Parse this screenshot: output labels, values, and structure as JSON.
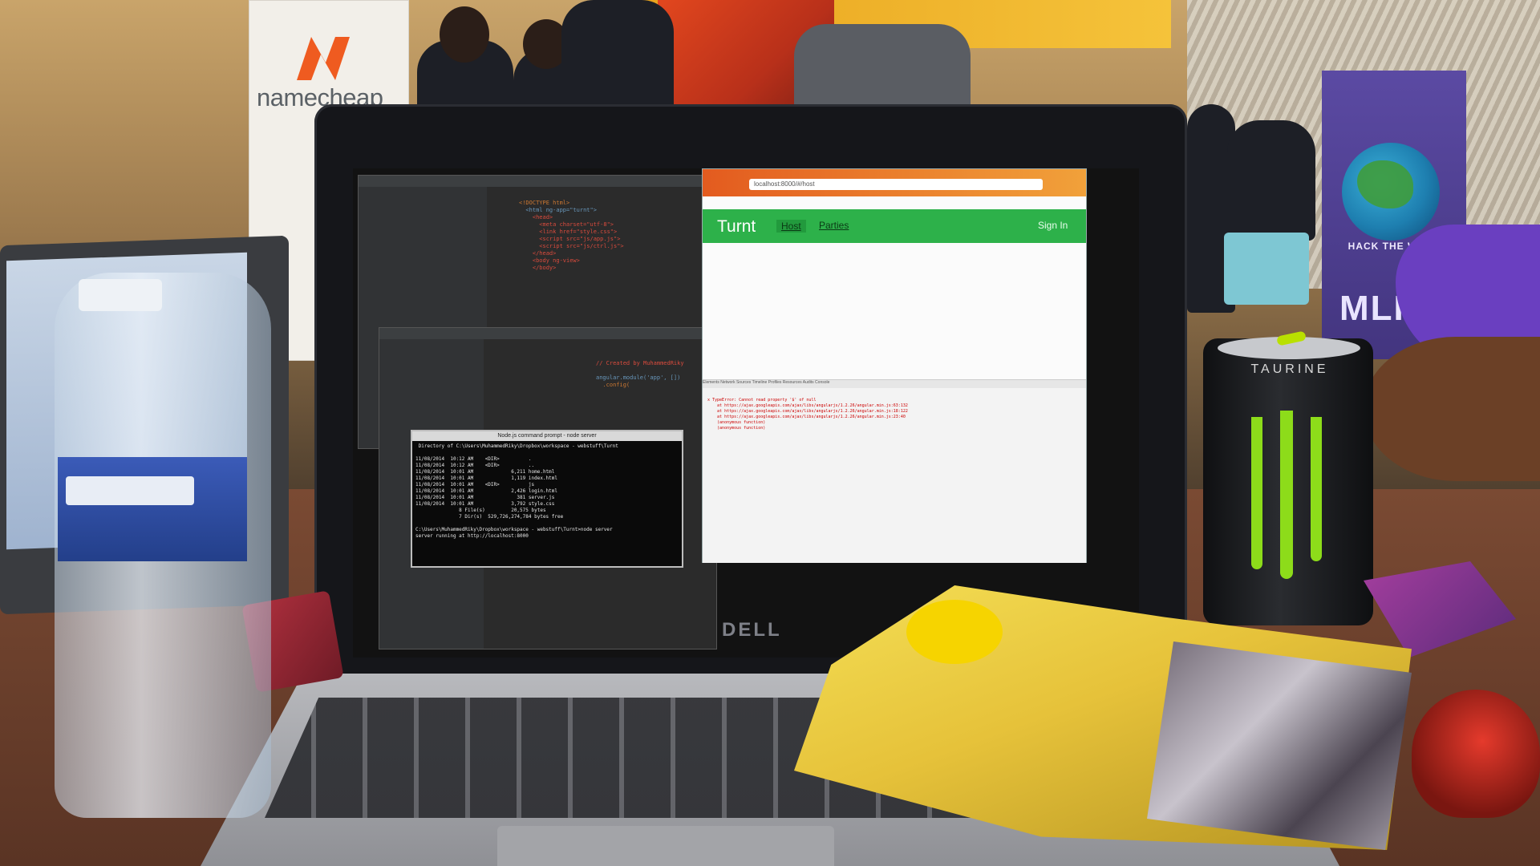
{
  "scene": {
    "description_colors": {
      "accent_green": "#2db14a",
      "chrome_orange": "#e35b1f",
      "can_green": "#8ddc1a"
    }
  },
  "banner_left": {
    "brand": "namecheap"
  },
  "banner_right": {
    "line1": "HACK THE WORLD",
    "line2": "MLH"
  },
  "laptop": {
    "brand": "DELL"
  },
  "browser": {
    "url": "localhost:8000/#/host",
    "app_brand": "Turnt",
    "nav": [
      {
        "label": "Host"
      },
      {
        "label": "Parties"
      }
    ],
    "sign_in": "Sign In",
    "devtools_tabs": "Elements  Network  Sources  Timeline  Profiles  Resources  Audits  Console"
  },
  "terminal": {
    "title": "Node.js command prompt - node  server",
    "lines": [
      " Directory of C:\\Users\\MuhammedRiky\\Dropbox\\workspace - webstuff\\Turnt",
      "",
      "11/08/2014  10:12 AM    <DIR>          .",
      "11/08/2014  10:12 AM    <DIR>          ..",
      "11/08/2014  10:01 AM             6,211 home.html",
      "11/08/2014  10:01 AM             1,119 index.html",
      "11/08/2014  10:01 AM    <DIR>          js",
      "11/08/2014  10:01 AM             2,426 login.html",
      "11/08/2014  10:01 AM               381 server.js",
      "11/08/2014  10:01 AM             3,792 style.css",
      "               8 File(s)         20,575 bytes",
      "               7 Dir(s)  529,726,274,784 bytes free",
      "",
      "C:\\Users\\MuhammedRiky\\Dropbox\\workspace - webstuff\\Turnt>node server",
      "server running at http://localhost:8000"
    ]
  },
  "can": {
    "text": "TAURINE"
  }
}
